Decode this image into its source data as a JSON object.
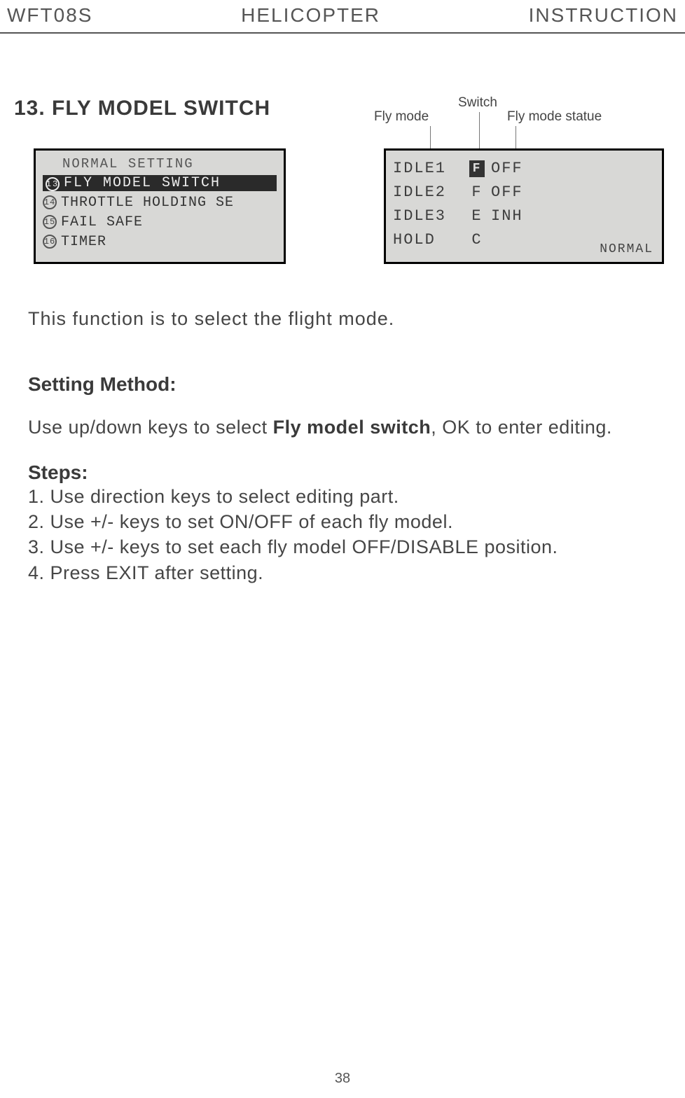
{
  "header": {
    "left": "WFT08S",
    "center": "HELICOPTER",
    "right": "INSTRUCTION"
  },
  "section_title": "13. FLY MODEL SWITCH",
  "callouts": {
    "fly_mode": "Fly mode",
    "switch": "Switch",
    "fly_mode_statue": "Fly mode statue"
  },
  "lcd_left": {
    "title": "NORMAL SETTING",
    "items": [
      {
        "num": "13",
        "label": "FLY MODEL SWITCH",
        "selected": true
      },
      {
        "num": "14",
        "label": "THROTTLE HOLDING SE",
        "selected": false
      },
      {
        "num": "15",
        "label": "FAIL SAFE",
        "selected": false
      },
      {
        "num": "16",
        "label": "TIMER",
        "selected": false
      }
    ]
  },
  "lcd_right": {
    "rows": [
      {
        "mode": "IDLE1",
        "switch": "F",
        "status": "OFF",
        "sw_boxed": true
      },
      {
        "mode": "IDLE2",
        "switch": "F",
        "status": "OFF",
        "sw_boxed": false
      },
      {
        "mode": "IDLE3",
        "switch": "E",
        "status": "INH",
        "sw_boxed": false
      },
      {
        "mode": "HOLD",
        "switch": "C",
        "status": "",
        "sw_boxed": false
      }
    ],
    "mode_label": "NORMAL"
  },
  "intro": "This function is to select the flight mode.",
  "setting_method_label": "Setting Method:",
  "setting_method_pre": "Use up/down keys to select ",
  "setting_method_bold": "Fly model switch",
  "setting_method_post": ", OK to enter editing.",
  "steps_label": "Steps:",
  "steps": [
    "1. Use direction keys to select editing part.",
    "2. Use +/- keys to set ON/OFF of each fly model.",
    "3. Use +/- keys to set each fly model OFF/DISABLE position.",
    "4. Press EXIT after setting."
  ],
  "page_number": "38"
}
